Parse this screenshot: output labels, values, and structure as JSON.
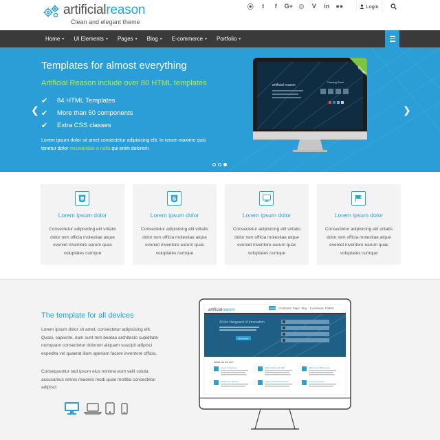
{
  "brand": {
    "name_part1": "artificial",
    "name_part2": "reason",
    "tagline": "Clean and elegant theme"
  },
  "social_icons": [
    "rss-icon",
    "twitter-icon",
    "facebook-icon",
    "google-plus-icon",
    "instagram-icon",
    "vimeo-icon",
    "linkedin-icon",
    "flickr-icon"
  ],
  "social_glyphs": [
    "⦿",
    "t",
    "f",
    "G+",
    "◎",
    "V",
    "in",
    "●●"
  ],
  "header": {
    "login_label": "Login"
  },
  "nav": {
    "items": [
      {
        "label": "Home",
        "has_caret": true
      },
      {
        "label": "UI Elements",
        "has_caret": true
      },
      {
        "label": "Pages",
        "has_caret": true
      },
      {
        "label": "Blog",
        "has_caret": true
      },
      {
        "label": "E-commerce",
        "has_caret": true
      },
      {
        "label": "Portfolio",
        "has_caret": true
      }
    ],
    "caret": "▾"
  },
  "hero": {
    "title": "Templates for almost everything",
    "subtitle": "Artificial Reason include over 80 HTML templates",
    "bullets": [
      "84 HTML Templates",
      "More than 50 components",
      "Extra CSS classes"
    ],
    "check_glyph": "✔",
    "text_before": "Lorem ipsum dolor sit amet consectetur adipisicing elit. In rerum maxime quis tenetur dolor ",
    "text_highlight": "recusandae a nulla",
    "text_after": " qui enim dolorem.",
    "badge": "Great!",
    "screen_logo": "artificial reason",
    "screen_title": "Coming Soon",
    "prev_glyph": "❮",
    "next_glyph": "❯",
    "slides": 3,
    "active_slide": 3
  },
  "features": [
    {
      "icon": "html5-icon",
      "title": "Lorem ipsum dolor",
      "text": "Consectetur adipisicing elit vritatis dolor rem officia molestiae atque eveniet inventore earum quas voluptates cumque"
    },
    {
      "icon": "css3-icon",
      "title": "Lorem ipsum dolor",
      "text": "Consectetur adipisicing elit vritatis dolor rem officia molestiae atque eveniet inventore earum quas voluptates cumque"
    },
    {
      "icon": "desktop-icon",
      "title": "Lorem ipsum dolor",
      "text": "Consectetur adipisicing elit vritatis dolor rem officia molestiae atque eveniet inventore earum quas voluptates cumque"
    },
    {
      "icon": "flag-icon",
      "title": "Lorem ipsum dolor",
      "text": "Consectetur adipisicing elit vritatis dolor rem officia molestiae atque eveniet inventore earum quas voluptates cumque"
    }
  ],
  "devices": {
    "title": "The template for all devices",
    "paragraph1": "Lorem ipsum dolor sit amet, consectetur adipisicing elit. Quasi, sapiente, nam sunt rem beatae architecto cupiditate numquam consectetur dolorum aliquam suscipit adipisci expedita vel quaerat illum aperiam facere inventore officia.",
    "paragraph2": "Consequuntur sed ipsum eius minima eum velit soluta accusamus omnis maiores modi quae mollitia consectetur adipisci.",
    "device_icons": [
      "desktop-icon",
      "laptop-icon",
      "tablet-icon",
      "phone-icon"
    ],
    "active_device": "desktop-icon"
  },
  "preview": {
    "brand_part1": "artificial",
    "brand_part2": "reason",
    "nav": [
      "Home",
      "UI Elements",
      "Pages",
      "Blog",
      "E-commerce",
      "Portfolio"
    ],
    "hero_title": "At the Vanguard of Innovation",
    "hero_button": "Learn More",
    "section_title": "What do we do?",
    "services": [
      "Cloud Computing",
      "Web Design and SEO",
      "Mobile and Tablet Apps",
      "Wordpress Themes",
      "Training and development",
      "Customer service"
    ]
  },
  "colors": {
    "accent": "#2a9fd6",
    "navbar": "#3a3a3a",
    "highlight": "#b9e84a",
    "hero_bg": "#2c9fd7",
    "panel_bg": "#f3f3f3"
  }
}
